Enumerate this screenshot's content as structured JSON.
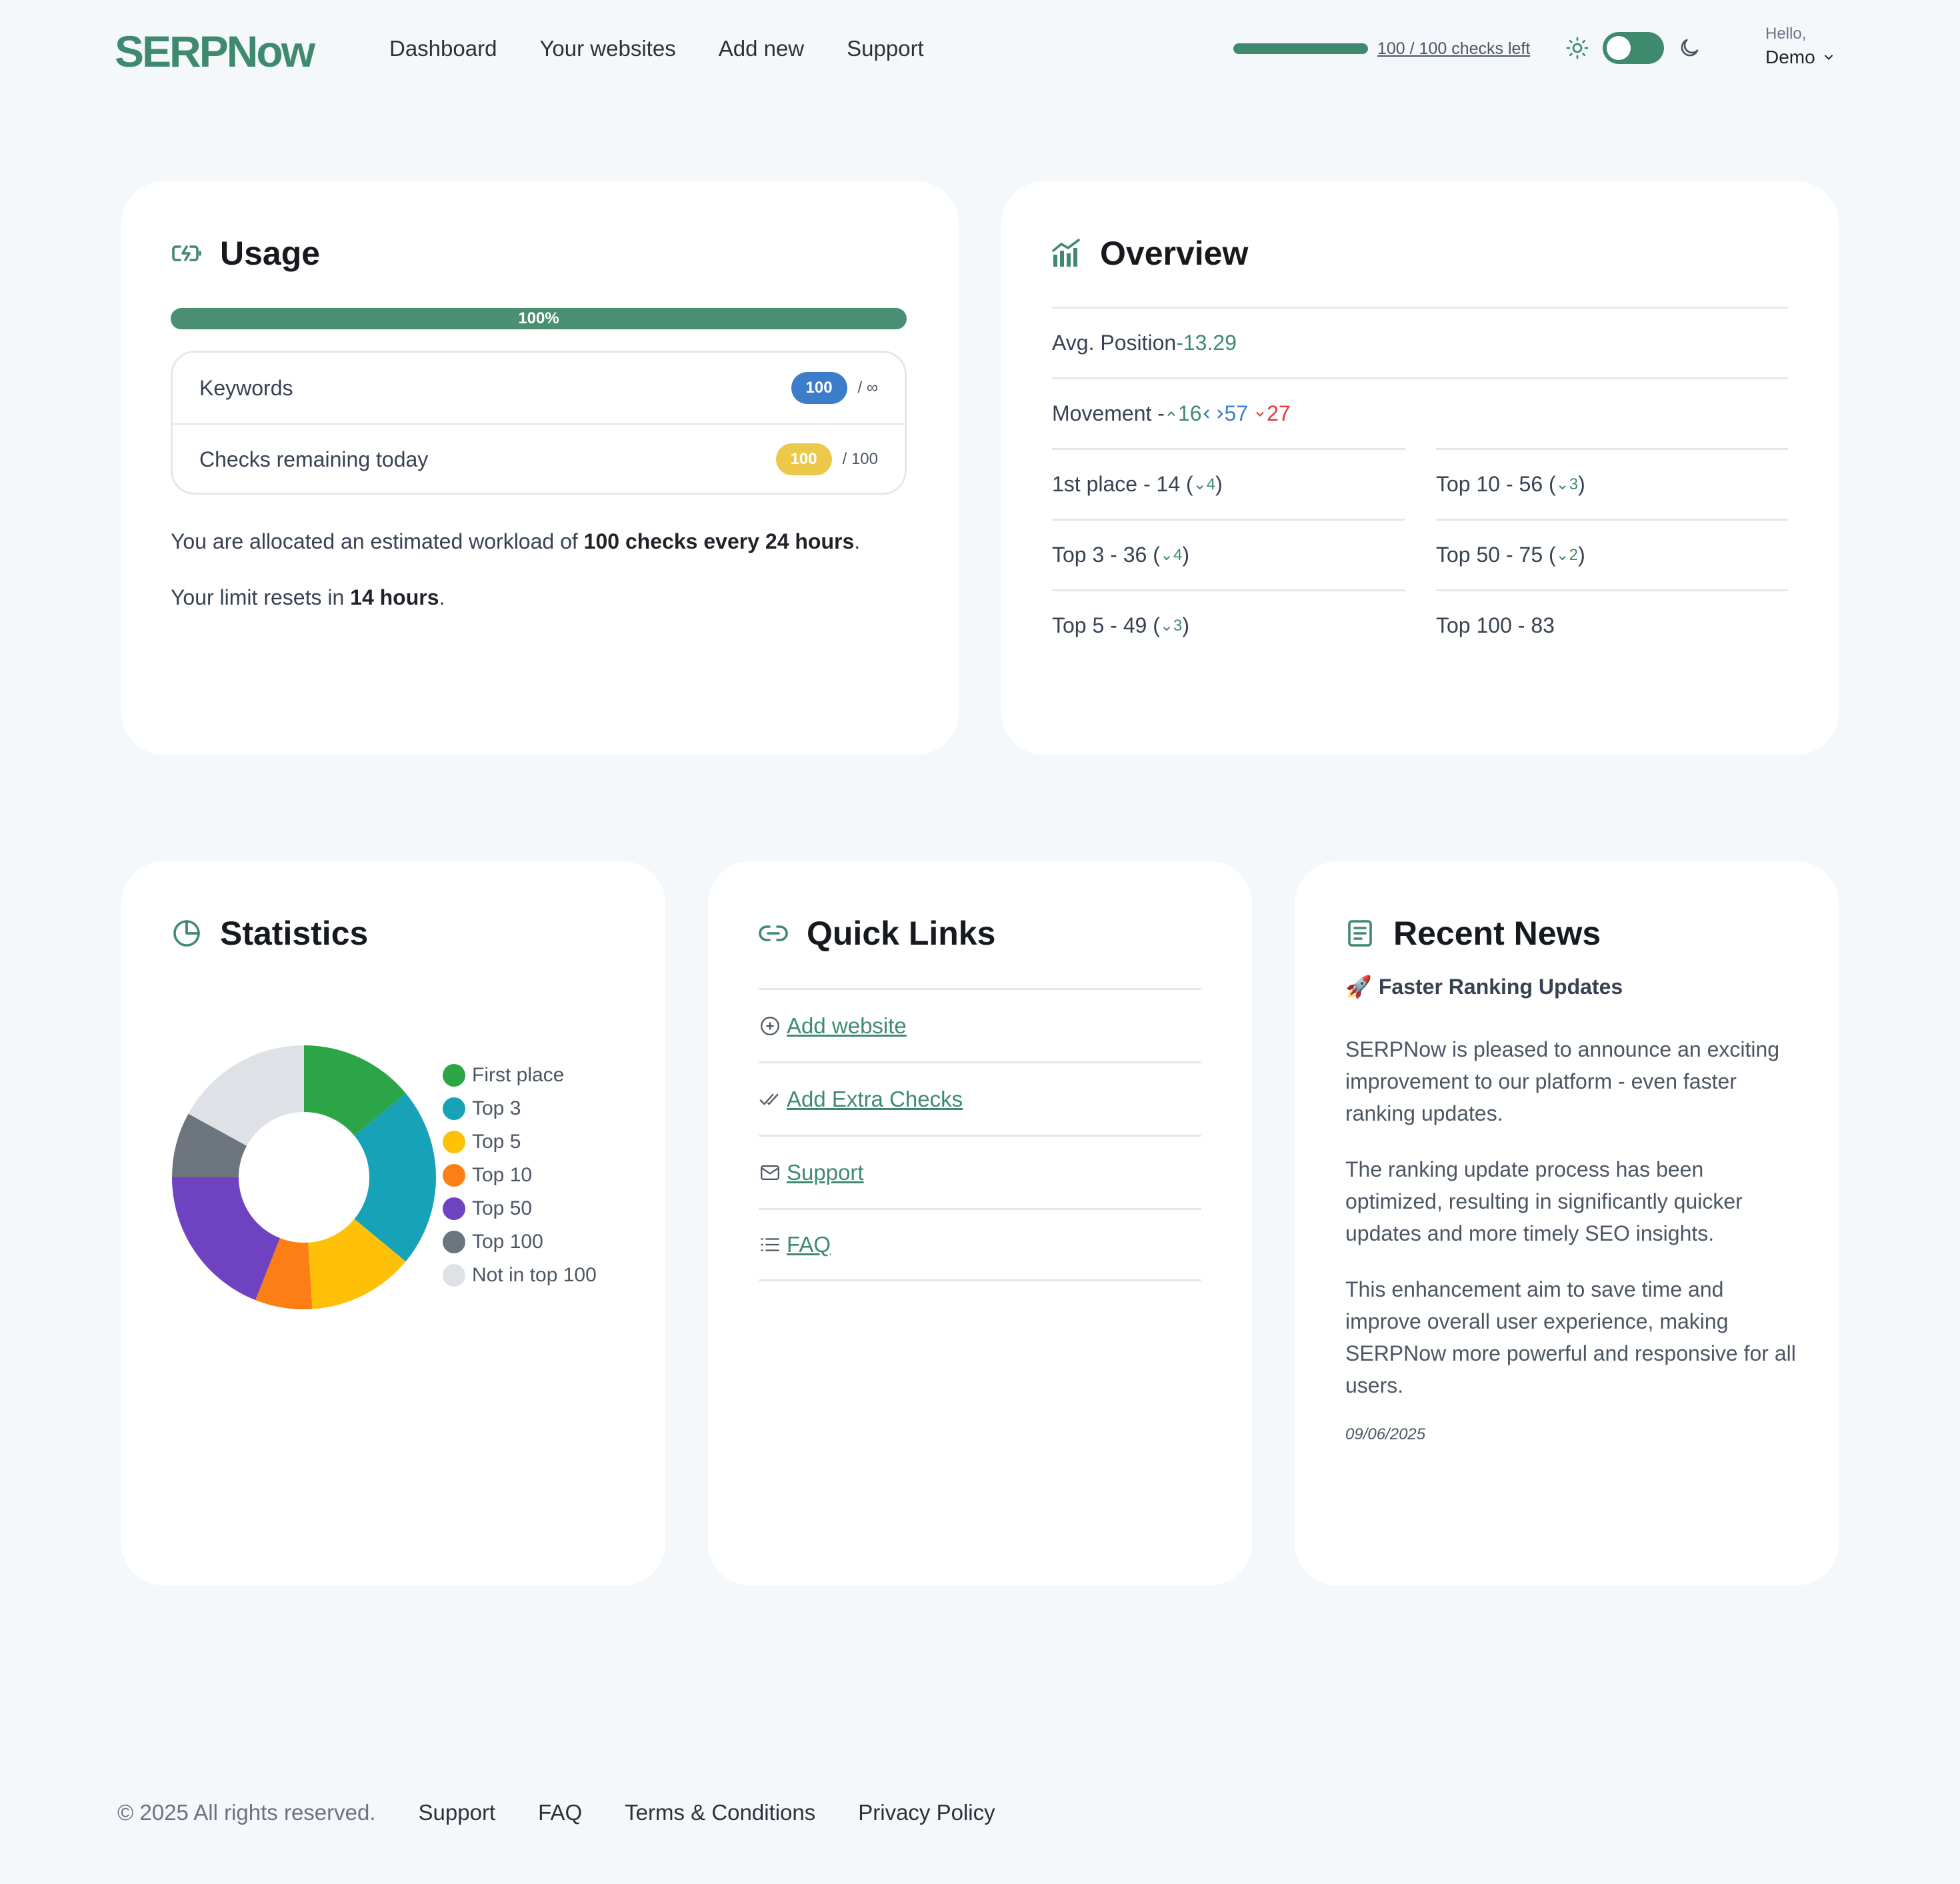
{
  "header": {
    "logo": "SERPNow",
    "nav": [
      "Dashboard",
      "Your websites",
      "Add new",
      "Support"
    ],
    "checks_left": "100 / 100 checks left",
    "checks_progress_fraction": 1.0,
    "greeting": "Hello,",
    "user_name": "Demo"
  },
  "usage": {
    "title": "Usage",
    "progress_label": "100%",
    "progress_percent": 100,
    "rows": [
      {
        "label": "Keywords",
        "value": "100",
        "of": "/ ∞"
      },
      {
        "label": "Checks remaining today",
        "value": "100",
        "of": "/ 100"
      }
    ],
    "workload_prefix": "You are allocated an estimated workload of ",
    "workload_bold": "100 checks every 24 hours",
    "workload_suffix": ".",
    "reset_prefix": "Your limit resets in ",
    "reset_bold": "14 hours",
    "reset_suffix": "."
  },
  "overview": {
    "title": "Overview",
    "avg_label": "Avg. Position ",
    "avg_value": "-13.29",
    "movement_label": "Movement - ",
    "movement_up": "16",
    "movement_same": "57",
    "movement_down": "27",
    "left": [
      {
        "label": "1st place - 14 (",
        "delta": "4",
        "close": ")"
      },
      {
        "label": "Top 3 - 36 (",
        "delta": "4",
        "close": ")"
      },
      {
        "label": "Top 5 - 49 (",
        "delta": "3",
        "close": ")"
      }
    ],
    "right": [
      {
        "label": "Top 10 - 56 (",
        "delta": "3",
        "close": ")"
      },
      {
        "label": "Top 50 - 75 (",
        "delta": "2",
        "close": ")"
      },
      {
        "label": "Top 100 - 83",
        "delta": "",
        "close": ""
      }
    ]
  },
  "statistics": {
    "title": "Statistics"
  },
  "chart_data": {
    "type": "pie",
    "donut": true,
    "legend_position": "right",
    "categories": [
      "First place",
      "Top 3",
      "Top 5",
      "Top 10",
      "Top 50",
      "Top 100",
      "Not in top 100"
    ],
    "values": [
      14,
      22,
      13,
      7,
      19,
      8,
      17
    ],
    "colors": [
      "#2ca546",
      "#17a2b8",
      "#ffc107",
      "#fd7e14",
      "#6f42c1",
      "#6c757d",
      "#dee2e6"
    ]
  },
  "quick_links": {
    "title": "Quick Links",
    "items": [
      {
        "label": "Add website",
        "icon": "plus-circle-icon"
      },
      {
        "label": "Add Extra Checks",
        "icon": "double-check-icon"
      },
      {
        "label": "Support",
        "icon": "envelope-icon"
      },
      {
        "label": "FAQ",
        "icon": "list-icon"
      }
    ]
  },
  "news": {
    "title": "Recent News",
    "headline_emoji": "🚀",
    "headline": "Faster Ranking Updates",
    "paragraphs": [
      "SERPNow is pleased to announce an exciting improvement to our platform - even faster ranking updates.",
      "The ranking update process has been optimized, resulting in significantly quicker updates and more timely SEO insights.",
      "This enhancement aim to save time and improve overall user experience, making SERPNow more powerful and responsive for all users."
    ],
    "date": "09/06/2025"
  },
  "footer": {
    "copyright": "© 2025 All rights reserved.",
    "links": [
      "Support",
      "FAQ",
      "Terms & Conditions",
      "Privacy Policy"
    ]
  },
  "colors": {
    "brand_green": "#3f8a6e",
    "accent_blue": "#3d7cc9",
    "down_red": "#e03b3b",
    "badge_yellow": "#ecc94b"
  }
}
